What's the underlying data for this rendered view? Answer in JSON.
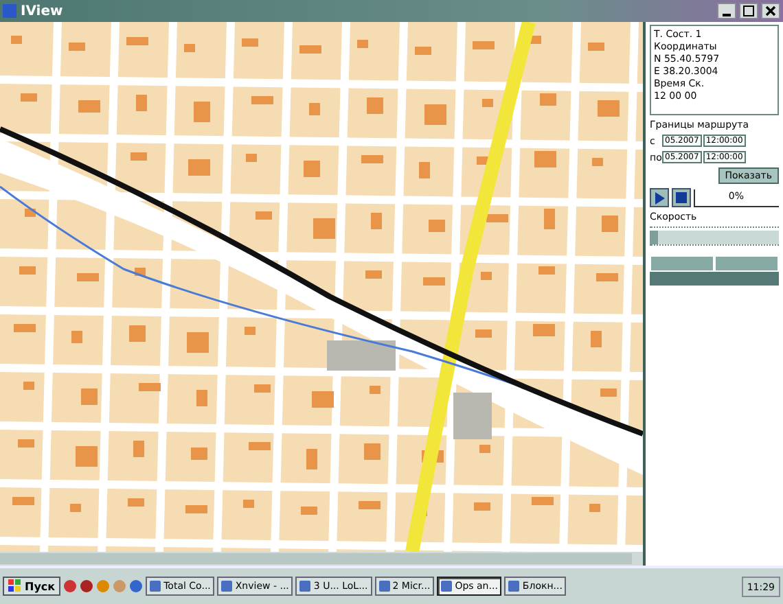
{
  "window": {
    "title": "IView"
  },
  "info": {
    "lines": [
      "Т. Сост. 1",
      "Координаты",
      "N 55.40.5797",
      "E 38.20.3004",
      "Время   Ск.",
      "12   00   00"
    ]
  },
  "route": {
    "heading": "Границы маршрута",
    "rows": [
      {
        "label": "с",
        "date": "05.2007",
        "time": "12:00:00"
      },
      {
        "label": "по",
        "date": "05.2007",
        "time": "12:00:00"
      }
    ],
    "show_button": "Показать"
  },
  "playback": {
    "progress": {
      "level": 0,
      "reading": "0%"
    },
    "speed_label": "Скорость",
    "speed": {
      "level": 0
    }
  },
  "taskbar": {
    "start": "Пуск",
    "tasks": [
      {
        "label": "Total Co...",
        "selected": false
      },
      {
        "label": "Xnview - ...",
        "selected": false
      },
      {
        "label": "3 U... LoL...",
        "selected": false
      },
      {
        "label": "2 Micr...",
        "selected": false
      },
      {
        "label": "Ops an...",
        "selected": true
      },
      {
        "label": "Блокн...",
        "selected": false
      }
    ],
    "clock": "11:29"
  }
}
